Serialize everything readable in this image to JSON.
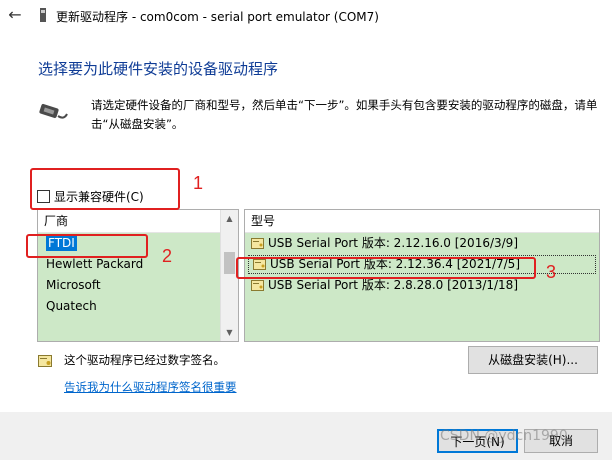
{
  "window": {
    "title": "更新驱动程序 - com0com - serial port emulator (COM7)"
  },
  "heading": "选择要为此硬件安装的设备驱动程序",
  "instructions": "请选定硬件设备的厂商和型号，然后单击“下一步”。如果手头有包含要安装的驱动程序的磁盘，请单击“从磁盘安装”。",
  "compatible_checkbox": {
    "label": "显示兼容硬件(C)",
    "checked": false
  },
  "manufacturer_list": {
    "header": "厂商",
    "items": [
      "FTDI",
      "Hewlett Packard",
      "Microsoft",
      "Quatech"
    ],
    "selected": "FTDI"
  },
  "model_list": {
    "header": "型号",
    "items": [
      "USB Serial Port 版本: 2.12.16.0 [2016/3/9]",
      "USB Serial Port 版本: 2.12.36.4 [2021/7/5]",
      "USB Serial Port 版本: 2.8.28.0 [2013/1/18]"
    ],
    "focused_index": 1
  },
  "signature": {
    "text": "这个驱动程序已经过数字签名。",
    "link": "告诉我为什么驱动程序签名很重要"
  },
  "buttons": {
    "have_disk": "从磁盘安装(H)...",
    "next": "下一页(N)",
    "cancel": "取消"
  },
  "watermark": "CSDN @ydcn1990",
  "annotations": [
    "1",
    "2",
    "3"
  ],
  "colors": {
    "heading": "#0f3c96",
    "list_background": "#cde8c7",
    "selection": "#0078d7",
    "annotation": "#e02020",
    "link": "#0066cc"
  }
}
